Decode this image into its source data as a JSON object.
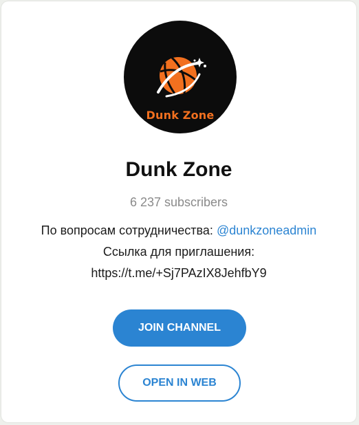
{
  "channel": {
    "logo_text": "Dunk Zone",
    "name": "Dunk Zone",
    "subscribers": "6 237 subscribers",
    "description_prefix": "По вопросам сотрудничества: ",
    "mention": "@dunkzoneadmin",
    "invite_label": "Ссылка для приглашения:",
    "invite_link": "https://t.me/+Sj7PAzIX8JehfbY9"
  },
  "buttons": {
    "join": "JOIN CHANNEL",
    "web": "OPEN IN WEB"
  },
  "colors": {
    "accent": "#2b84d2",
    "logo_orange": "#f2701f",
    "avatar_bg": "#0c0c0c"
  },
  "icons": {
    "avatar_graphic": "basketball-icon"
  }
}
